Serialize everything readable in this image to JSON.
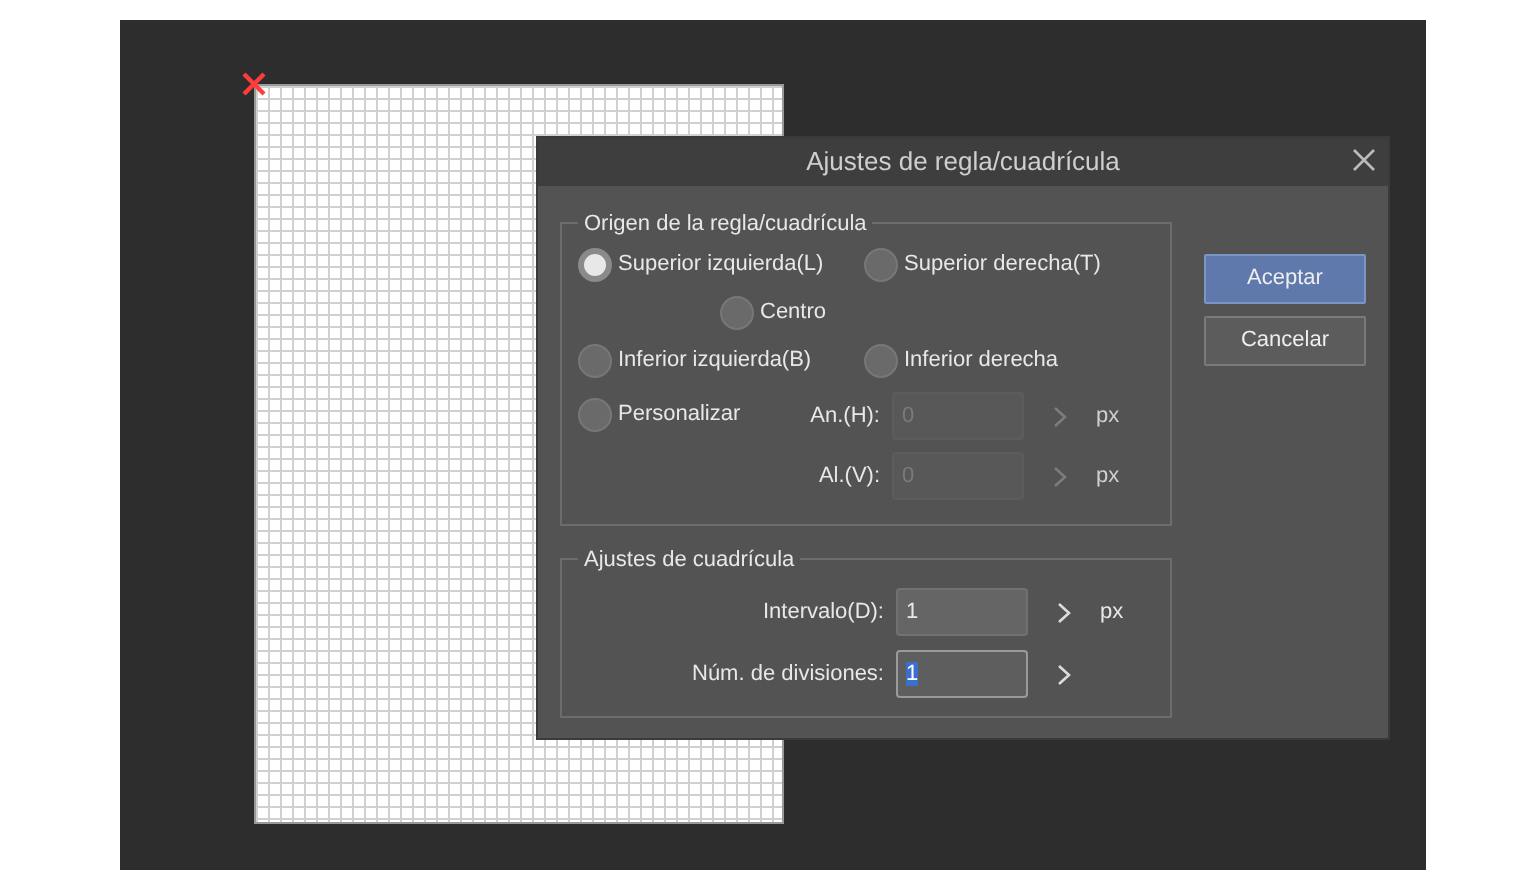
{
  "window": {
    "title": "Ajustes de regla/cuadrícula"
  },
  "origin_group": {
    "title": "Origen de la regla/cuadrícula",
    "options": [
      {
        "label": "Superior izquierda(L)",
        "selected": true
      },
      {
        "label": "Superior derecha(T)",
        "selected": false
      },
      {
        "label": "Centro",
        "selected": false
      },
      {
        "label": "Inferior izquierda(B)",
        "selected": false
      },
      {
        "label": "Inferior derecha",
        "selected": false
      },
      {
        "label": "Personalizar",
        "selected": false
      }
    ],
    "custom_fields": [
      {
        "label": "An.(H):",
        "value": "0",
        "unit": "px",
        "disabled": true
      },
      {
        "label": "Al.(V):",
        "value": "0",
        "unit": "px",
        "disabled": true
      }
    ]
  },
  "grid_group": {
    "title": "Ajustes de cuadrícula",
    "fields": [
      {
        "label": "Intervalo(D):",
        "value": "1",
        "unit": "px",
        "focused": false
      },
      {
        "label": "Núm. de divisiones:",
        "value": "1",
        "focused": true
      }
    ]
  },
  "buttons": [
    {
      "label": "Aceptar",
      "kind": "primary"
    },
    {
      "label": "Cancelar",
      "kind": "secondary"
    }
  ]
}
